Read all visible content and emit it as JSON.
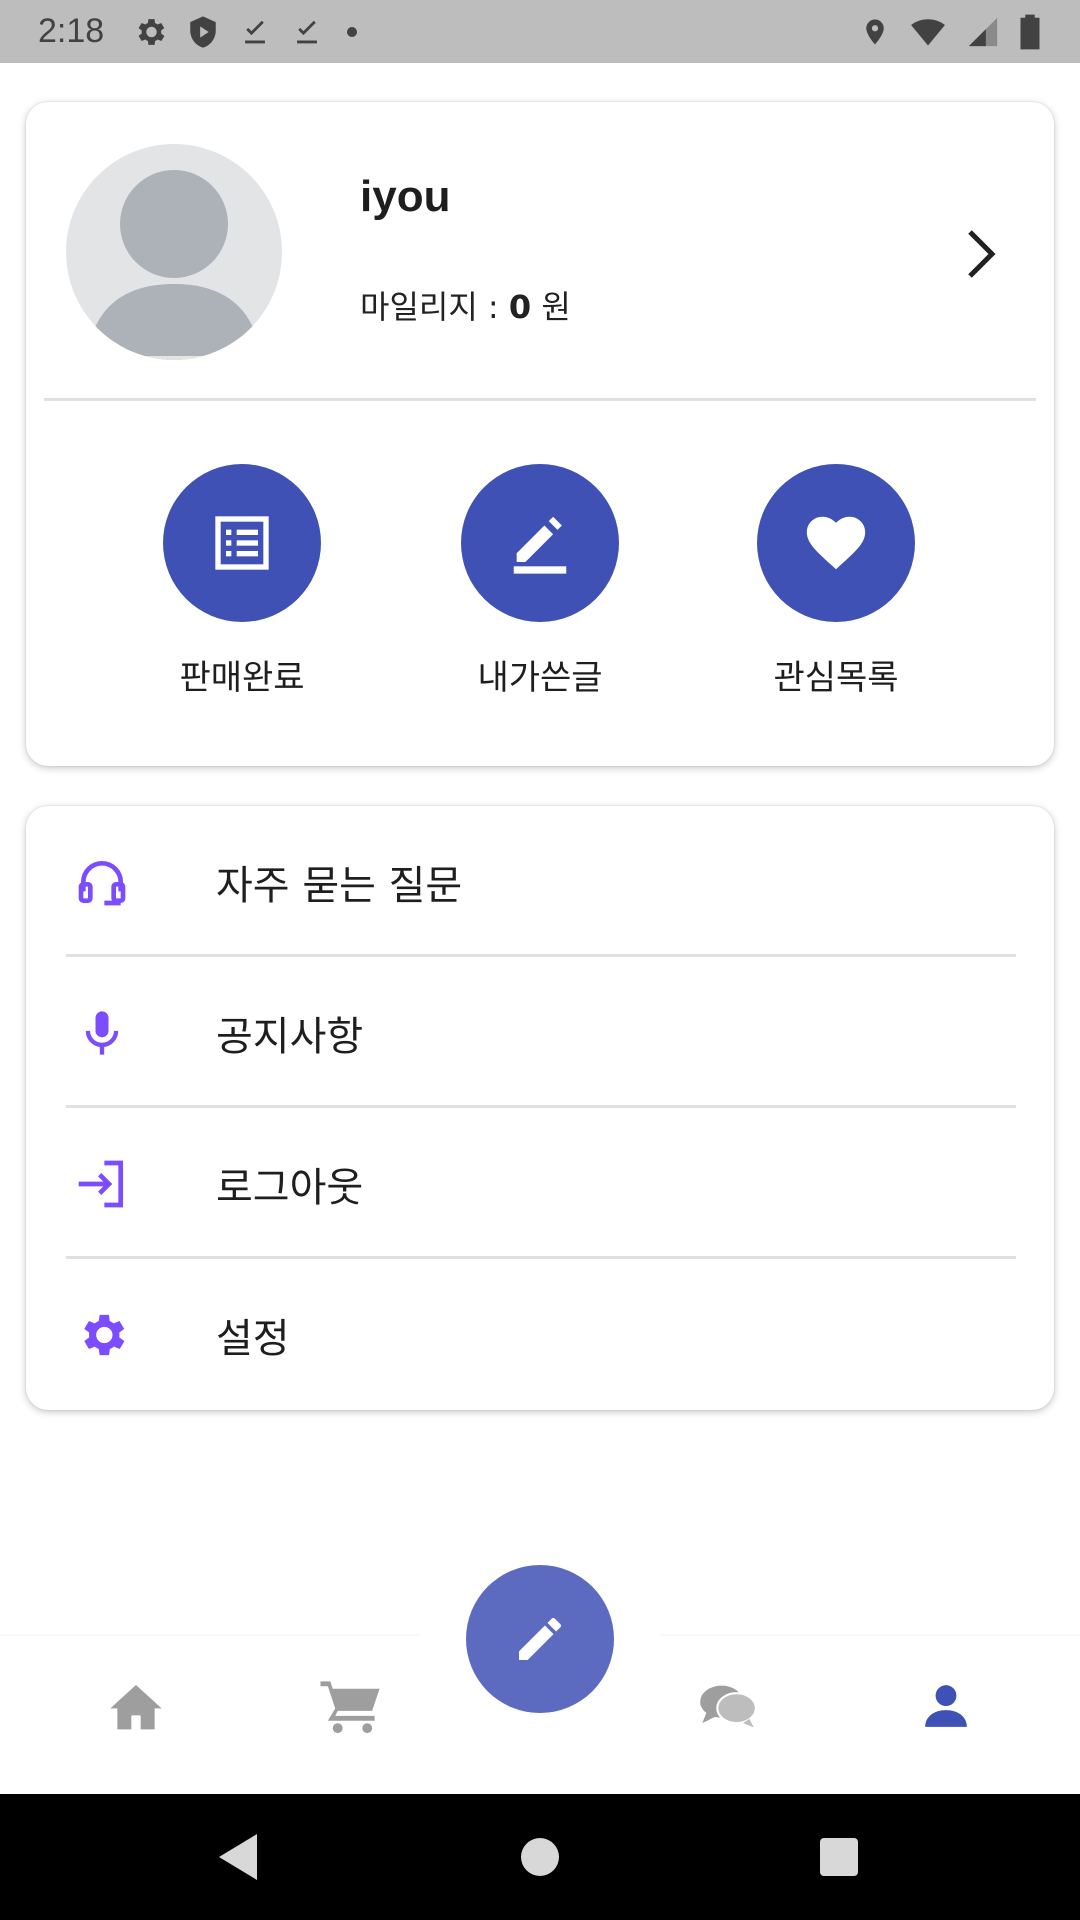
{
  "status_bar": {
    "time": "2:18",
    "icons_left": [
      "gear-icon",
      "shield-icon",
      "download-done-icon",
      "download-done-icon",
      "dot-icon"
    ],
    "icons_right": [
      "location-icon",
      "wifi-icon",
      "signal-icon",
      "battery-icon"
    ]
  },
  "profile": {
    "username": "iyou",
    "mileage_label": "마일리지 : ",
    "mileage_value": "0",
    "mileage_unit": " 원"
  },
  "quick_actions": [
    {
      "label": "판매완료",
      "icon": "list-icon"
    },
    {
      "label": "내가쓴글",
      "icon": "edit-icon"
    },
    {
      "label": "관심목록",
      "icon": "heart-icon"
    }
  ],
  "menu": [
    {
      "label": "자주 묻는 질문",
      "icon": "headset-icon"
    },
    {
      "label": "공지사항",
      "icon": "microphone-icon"
    },
    {
      "label": "로그아웃",
      "icon": "logout-icon"
    },
    {
      "label": "설정",
      "icon": "settings-icon"
    }
  ],
  "bottom_nav": {
    "items": [
      "home-icon",
      "cart-icon",
      "write-fab",
      "chat-icon",
      "person-icon"
    ],
    "active": "person-icon"
  },
  "colors": {
    "accent": "#3f51b5",
    "fab": "#5c6bc0",
    "menu_icon": "#7c4dff",
    "nav_inactive": "#9e9e9e",
    "nav_active": "#3f51b5"
  }
}
